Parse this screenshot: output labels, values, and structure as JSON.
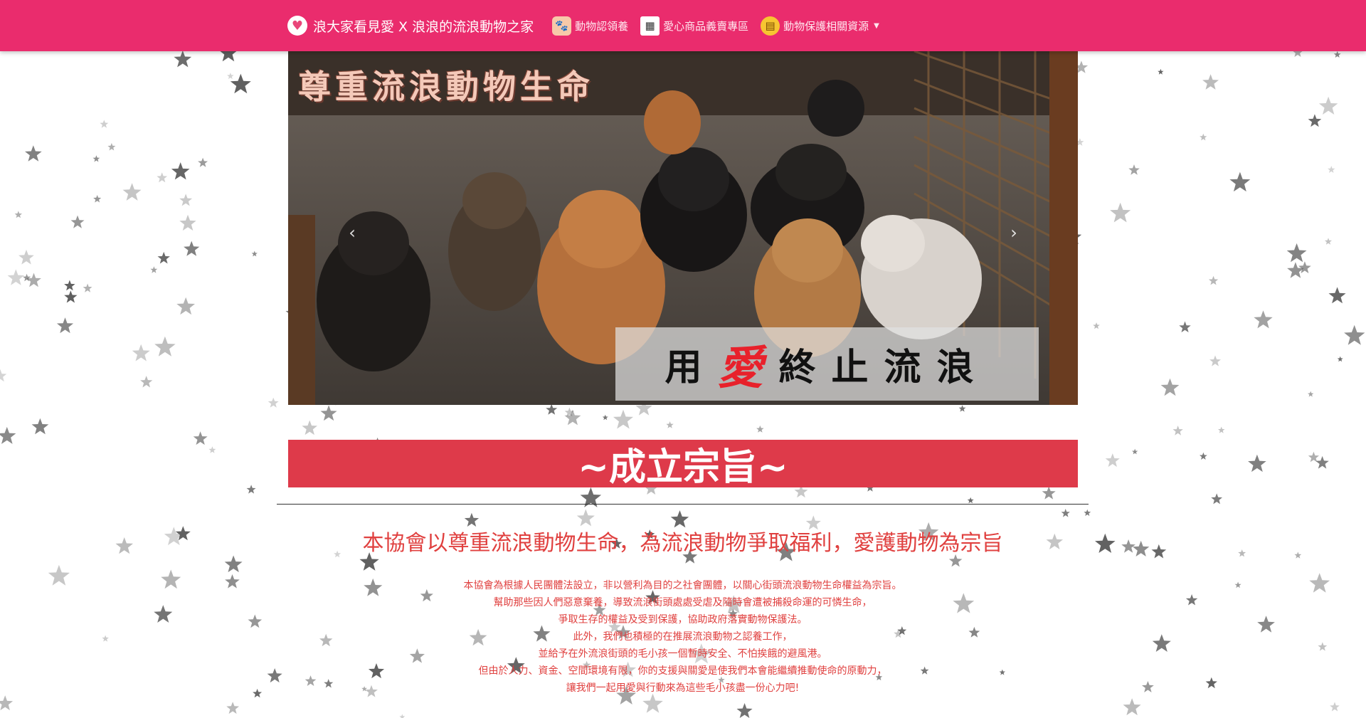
{
  "navbar": {
    "brand": "浪大家看見愛 X 浪浪的流浪動物之家",
    "items": [
      {
        "label": "動物認領養",
        "icon": "dog-adopt-icon"
      },
      {
        "label": "愛心商品義賣專區",
        "icon": "shop-icon"
      },
      {
        "label": "動物保護相關資源",
        "icon": "clipboard-icon",
        "dropdown": true
      }
    ],
    "background_color": "#ea2c6d"
  },
  "carousel": {
    "slide_title": "尊重流浪動物生命",
    "caption_before": "用",
    "caption_highlight": "愛",
    "caption_after": "終止流浪",
    "prev_icon": "chevron-left-icon",
    "next_icon": "chevron-right-icon"
  },
  "section": {
    "heading": "~成立宗旨~",
    "heading_bg": "#de3a4a",
    "subtitle": "本協會以尊重流浪動物生命，為流浪動物爭取福利，愛護動物為宗旨",
    "paragraph": [
      "本協會為根據人民團體法設立，非以營利為目的之社會團體，以關心街頭流浪動物生命權益為宗旨。",
      "幫助那些因人們惡意棄養，導致流浪街頭處處受虐及隨時會遭被捕殺命運的可憐生命，",
      "爭取生存的權益及受到保護，協助政府落實動物保護法。",
      "此外，我們也積極的在推展流浪動物之認養工作，",
      "並給予在外流浪街頭的毛小孩一個暫時安全、不怕挨餓的避風港。",
      "但由於人力、資金、空間環境有限，你的支援與關愛是使我們本會能繼續推動使命的原動力，",
      "讓我們一起用愛與行動來為這些毛小孩盡一份心力吧!"
    ],
    "text_color": "#e0403f"
  },
  "background": {
    "pattern": "star-icon",
    "star_color": "#555555"
  }
}
